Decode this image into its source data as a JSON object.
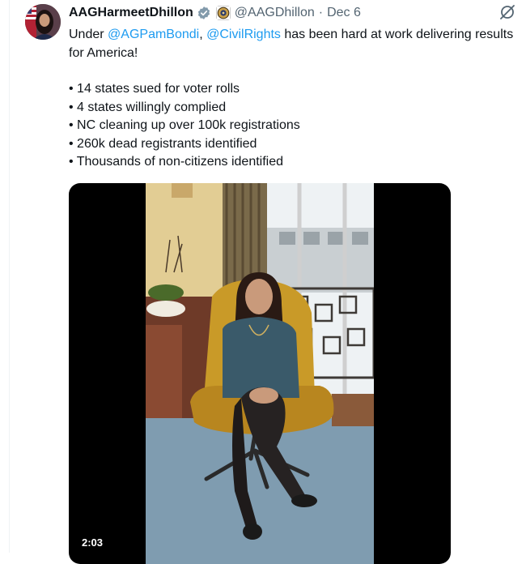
{
  "tweet": {
    "display_name": "AAGHarmeetDhillon",
    "handle": "@AAGDhillon",
    "separator": "·",
    "date": "Dec 6",
    "text_prefix": "Under ",
    "mention_1": "@AGPamBondi",
    "text_middle": ", ",
    "mention_2": "@CivilRights",
    "text_suffix": " has been hard at work delivering results for America!",
    "bullets": [
      "• 14 states sued for voter rolls",
      "• 4 states willingly complied",
      "• NC cleaning up over 100k registrations",
      "• 260k dead registrants identified",
      "• Thousands of non-citizens identified"
    ]
  },
  "media": {
    "duration": "2:03"
  },
  "icons": {
    "verified": "verified-badge-icon",
    "affiliation": "doj-seal-icon",
    "grok": "grok-icon"
  },
  "colors": {
    "link": "#1d9bf0",
    "secondary_text": "#536471",
    "badge": "#829aab"
  }
}
